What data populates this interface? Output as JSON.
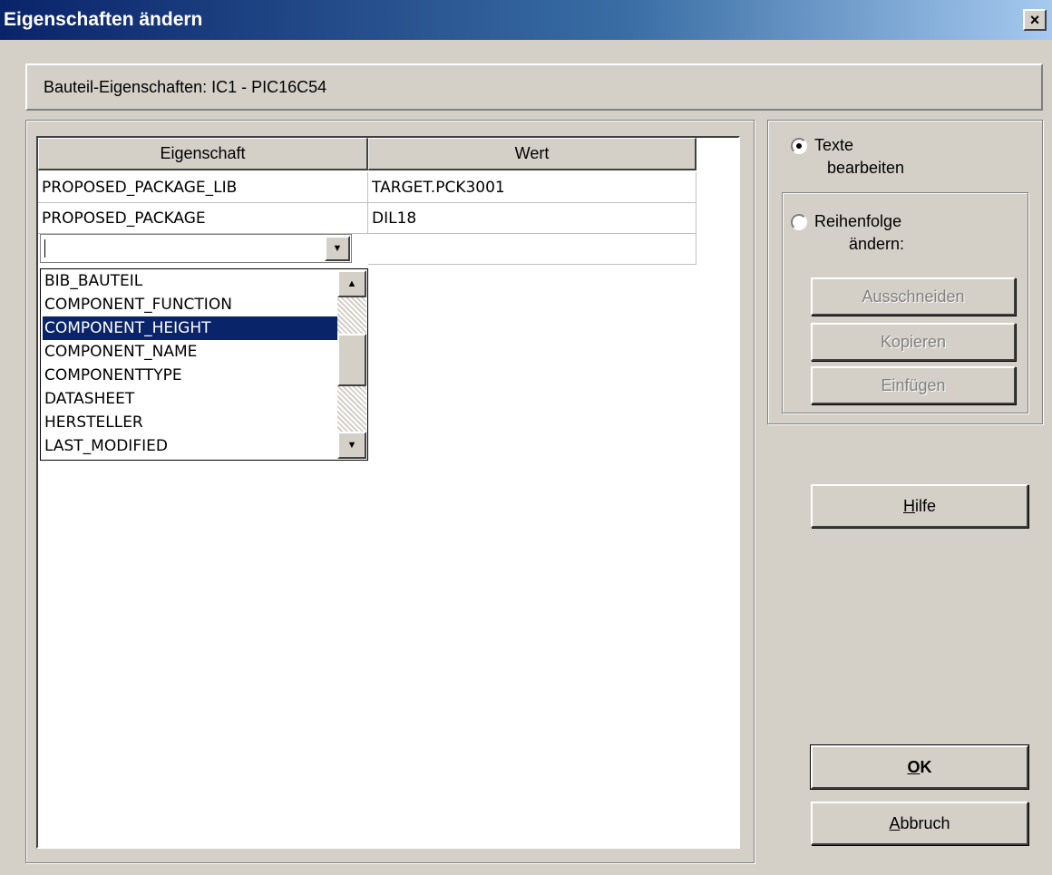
{
  "window": {
    "title": "Eigenschaften ändern",
    "close_glyph": "×"
  },
  "header": {
    "text": "Bauteil-Eigenschaften: IC1 - PIC16C54"
  },
  "grid": {
    "columns": [
      "Eigenschaft",
      "Wert"
    ],
    "rows": [
      [
        "PROPOSED_PACKAGE_LIB",
        "TARGET.PCK3001"
      ],
      [
        "PROPOSED_PACKAGE",
        "DIL18"
      ]
    ],
    "combo_value": ""
  },
  "dropdown": {
    "items": [
      "BIB_BAUTEIL",
      "COMPONENT_FUNCTION",
      "COMPONENT_HEIGHT",
      "COMPONENT_NAME",
      "COMPONENTTYPE",
      "DATASHEET",
      "HERSTELLER",
      "LAST_MODIFIED"
    ],
    "selected_index": 2
  },
  "options": {
    "radio_texte_line1": "Texte",
    "radio_texte_line2": "bearbeiten",
    "radio_reihenfolge_line1": "Reihenfolge",
    "radio_reihenfolge_line2": "ändern:",
    "selected": "texte"
  },
  "edit_buttons": {
    "cut": "Ausschneiden",
    "copy": "Kopieren",
    "paste": "Einfügen"
  },
  "buttons": {
    "help_mnemonic": "H",
    "help_rest": "ilfe",
    "ok_mnemonic": "O",
    "ok_rest": "K",
    "cancel_mnemonic": "A",
    "cancel_rest": "bbruch"
  },
  "icons": {
    "dropdown_arrow": "▼",
    "scroll_up": "▲",
    "scroll_down": "▼"
  }
}
